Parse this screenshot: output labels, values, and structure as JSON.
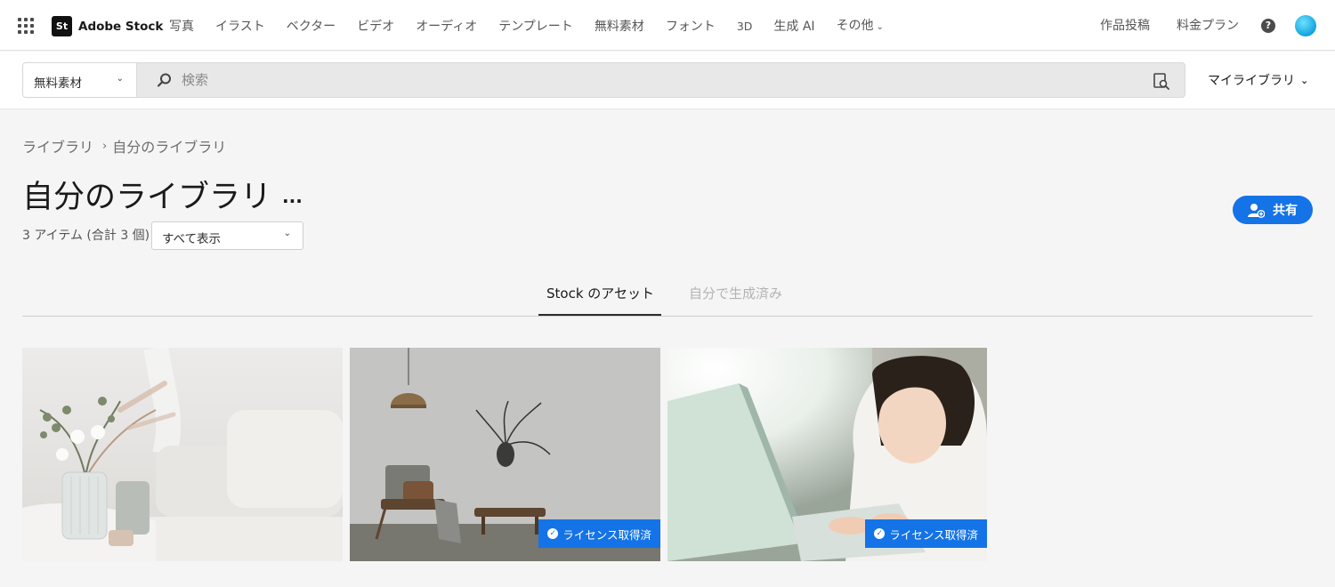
{
  "topbar": {
    "logo_mark": "St",
    "logo_text": "Adobe Stock",
    "nav": [
      "写真",
      "イラスト",
      "ベクター",
      "ビデオ",
      "オーディオ",
      "テンプレート",
      "無料素材",
      "フォント",
      "3D",
      "生成 AI",
      "その他"
    ],
    "right": [
      "作品投稿",
      "料金プラン"
    ],
    "help": "?"
  },
  "search": {
    "category": "無料素材",
    "placeholder": "検索",
    "my_library": "マイライブラリ"
  },
  "page": {
    "breadcrumb": [
      "ライブラリ",
      "自分のライブラリ"
    ],
    "title": "自分のライブラリ",
    "more": "...",
    "count": "3 アイテム (合計 3 個)",
    "filter": "すべて表示",
    "share": "共有"
  },
  "tabs": [
    "Stock のアセット",
    "自分で生成済み"
  ],
  "assets": [
    {
      "badge": ""
    },
    {
      "badge": "ライセンス取得済"
    },
    {
      "badge": "ライセンス取得済"
    }
  ],
  "colors": {
    "accent": "#1473e6",
    "background": "#f5f5f5"
  }
}
